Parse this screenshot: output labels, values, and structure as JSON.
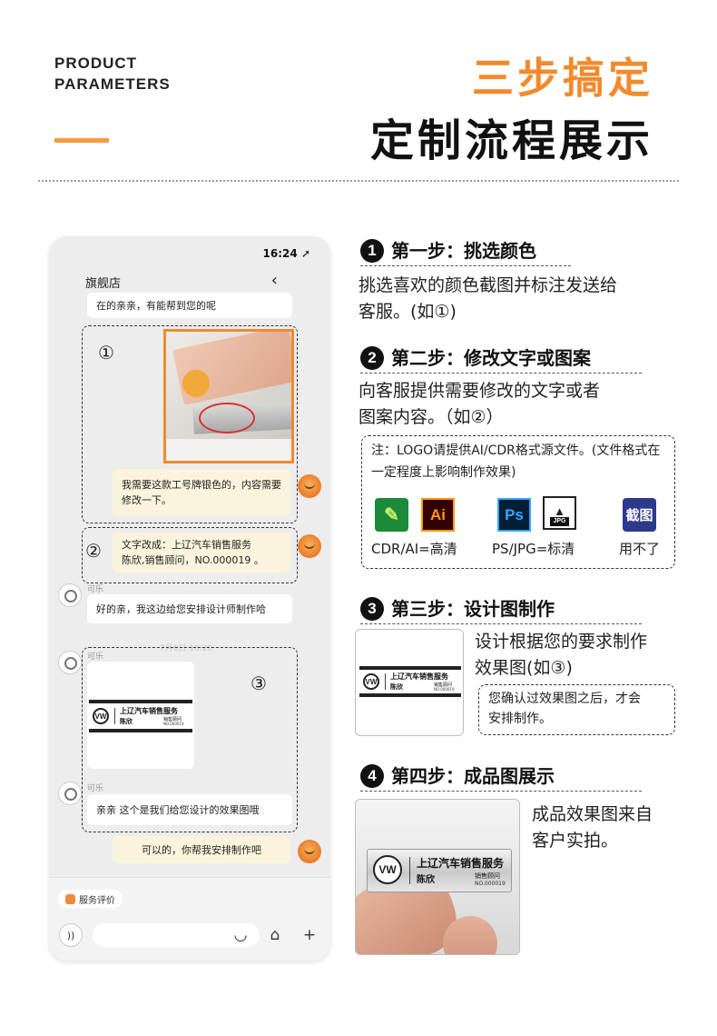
{
  "header": {
    "en_line1": "PRODUCT",
    "en_line2": "PARAMETERS",
    "title_accent": "三步搞定",
    "title_main": "定制流程展示"
  },
  "phone": {
    "time": "16:24",
    "store_name": "旗舰店",
    "messages": {
      "greeting": "在的亲亲，有能帮到您的呢",
      "request": "我需要这款工号牌银色的，内容需要修改一下。",
      "text_change": "文字改成：上辽汽车销售服务\n陈欣,销售顾问，NO.000019 。",
      "reply": "好的亲，我这边给您安排设计师制作哈",
      "effect": "亲亲 这个是我们给您设计的效果图哦",
      "confirm": "可以的，你帮我安排制作吧"
    },
    "nickname": "可乐",
    "timestamp": "7月6日 16:20",
    "markers": [
      "①",
      "②",
      "③"
    ],
    "service_rating": "服务评价"
  },
  "nameplate": {
    "company": "上辽汽车销售服务",
    "name": "陈欣",
    "role": "销售顾问",
    "number": "NO.000019"
  },
  "steps": [
    {
      "num": "1",
      "title": "第一步：挑选颜色",
      "desc": "挑选喜欢的颜色截图并标注发送给\n客服。(如①)"
    },
    {
      "num": "2",
      "title": "第二步：修改文字或图案",
      "desc": "向客服提供需要修改的文字或者\n图案内容。（如②）"
    },
    {
      "num": "3",
      "title": "第三步：设计图制作",
      "desc": "设计根据您的要求制作\n效果图(如③)"
    },
    {
      "num": "4",
      "title": "第四步：成品图展示",
      "desc": "成品效果图来自\n客户实拍。"
    }
  ],
  "note_format": "注：LOGO请提供AI/CDR格式源文件。(文件格式在一定程度上影响制作效果)",
  "formats": {
    "ai_icon": "Ai",
    "ps_icon": "Ps",
    "jpg_icon": "JPG",
    "screenshot_icon": "截图",
    "label_high": "CDR/AI=高清",
    "label_std": "PS/JPG=标清",
    "label_no": "用不了"
  },
  "note_confirm": "您确认过效果图之后，才会\n安排制作。",
  "colors": {
    "accent": "#f28a2e",
    "dark": "#111111"
  }
}
